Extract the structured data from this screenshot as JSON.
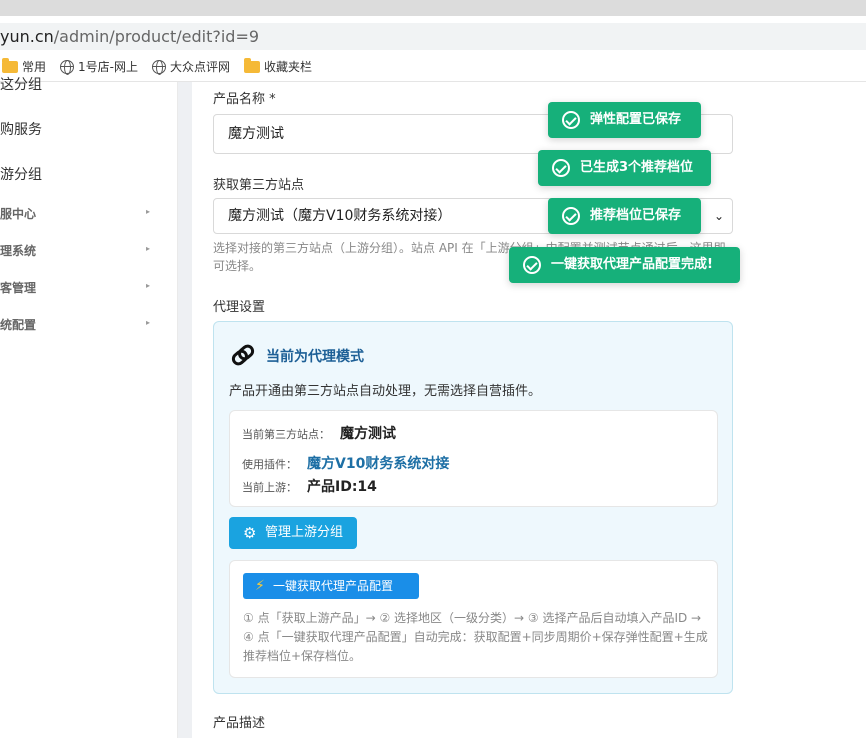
{
  "browser": {
    "url_host": "yun.cn",
    "url_path": "/admin/product/edit?id=9",
    "bookmarks": [
      {
        "label": "常用",
        "icon": "folder-icon"
      },
      {
        "label": "1号店-网上",
        "icon": "globe-icon"
      },
      {
        "label": "大众点评网",
        "icon": "globe-icon"
      },
      {
        "label": "收藏夹栏",
        "icon": "folder-icon"
      }
    ]
  },
  "sidebar": {
    "items": [
      {
        "label": "这分组"
      },
      {
        "label": "购服务"
      },
      {
        "label": "游分组"
      }
    ],
    "sub_items": [
      {
        "label": "服中心",
        "arrow": "▸"
      },
      {
        "label": "理系统",
        "arrow": "▸"
      },
      {
        "label": "客管理",
        "arrow": "▸"
      },
      {
        "label": "统配置",
        "arrow": "▸"
      }
    ]
  },
  "form": {
    "product_name_label": "产品名称 *",
    "product_name_value": "魔方测试",
    "third_party_label": "获取第三方站点",
    "third_party_value": "魔方测试（魔方V10财务系统对接）",
    "third_party_help": "选择对接的第三方站点（上游分组）。站点 API 在「上游分组」中配置并测试节点通过后，这里即可选择。",
    "agent_settings_label": "代理设置",
    "product_desc_label": "产品描述"
  },
  "agent": {
    "mode_title": "当前为代理模式",
    "mode_desc": "产品开通由第三方站点自动处理，无需选择自营插件。",
    "current_site_label": "当前第三方站点：",
    "current_site_value": "魔方测试",
    "plugin_label": "使用插件：",
    "plugin_value": "魔方V10财务系统对接",
    "upstream_label": "当前上游：",
    "upstream_value": "产品ID:14",
    "manage_button": "管理上游分组",
    "fetch_button": "一键获取代理产品配置",
    "steps_text": "① 点「获取上游产品」→ ② 选择地区（一级分类）→ ③ 选择产品后自动填入产品ID → ④ 点「一键获取代理产品配置」自动完成：获取配置+同步周期价+保存弹性配置+生成推荐档位+保存档位。"
  },
  "toasts": [
    {
      "message": "弹性配置已保存"
    },
    {
      "message": "已生成3个推荐档位"
    },
    {
      "message": "推荐档位已保存"
    },
    {
      "message": "一键获取代理产品配置完成!"
    }
  ],
  "colors": {
    "toast_bg": "#16b07a",
    "accent_blue": "#1aa3e0",
    "fetch_blue": "#1a8ee8",
    "agent_box_bg": "#eef8fd"
  }
}
